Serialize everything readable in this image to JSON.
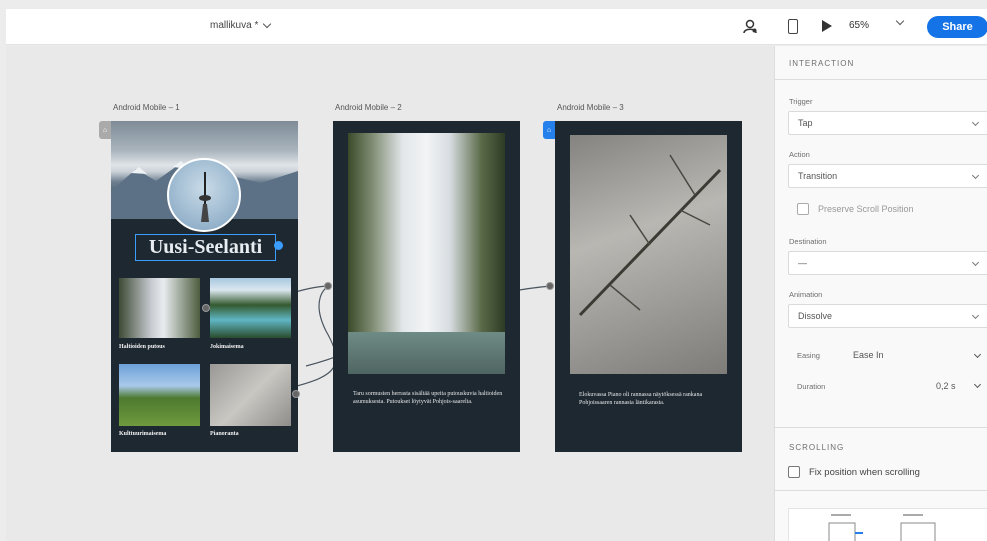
{
  "topbar": {
    "doc_title": "mallikuva *",
    "zoom": "65%",
    "share_label": "Share"
  },
  "icons": {
    "user": "user-icon",
    "device": "mobile-device-icon",
    "play": "play-icon",
    "home": "home-icon"
  },
  "artboards": [
    {
      "label": "Android Mobile – 1",
      "title": "Uusi-Seelanti",
      "thumbs": [
        {
          "caption": "Haltioiden putous"
        },
        {
          "caption": "Jokimaisema"
        },
        {
          "caption": "Kulttuurimaisema"
        },
        {
          "caption": "Pianoranta"
        }
      ]
    },
    {
      "label": "Android Mobile – 2",
      "description": "Taru sormusten herrasta sisältää upeita putouskuvia haltioiden asumuksesta. Putoukset löytyvät Pohjois-saarelta."
    },
    {
      "label": "Android Mobile – 3",
      "description": "Elokuvassa Piano oli rannassa näytöksessä rankana Pohjoissaaren rannasta läntikarasta."
    }
  ],
  "panel": {
    "interaction_title": "INTERACTION",
    "trigger_label": "Trigger",
    "trigger_value": "Tap",
    "action_label": "Action",
    "action_value": "Transition",
    "preserve_scroll": "Preserve Scroll Position",
    "destination_label": "Destination",
    "destination_value": "—",
    "animation_label": "Animation",
    "animation_value": "Dissolve",
    "easing_label": "Easing",
    "easing_value": "Ease In",
    "duration_label": "Duration",
    "duration_value": "0,2 s",
    "scrolling_title": "SCROLLING",
    "fix_position": "Fix position when scrolling"
  },
  "colors": {
    "accent": "#1473e6",
    "artboard_bg": "#1d2831",
    "canvas_bg": "#e9e9e9"
  }
}
